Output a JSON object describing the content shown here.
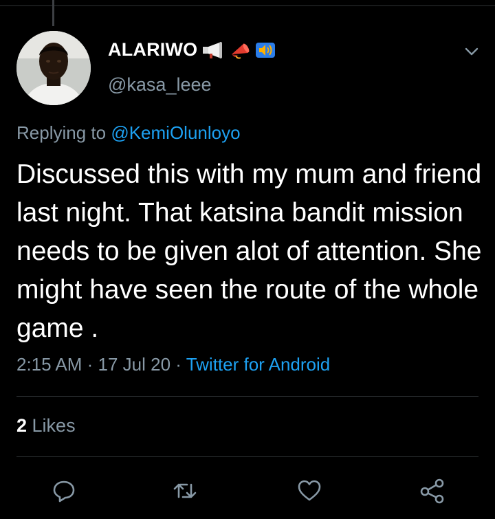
{
  "tweet": {
    "display_name": "ALARIWO",
    "handle": "@kasa_leee",
    "replying_prefix": "Replying to ",
    "replying_to": "@KemiOlunloyo",
    "text": "Discussed this with my mum and friend last night.  That katsina bandit mission needs to be given alot of attention.  She might have seen the route of the whole game .",
    "time": "2:15 AM",
    "separator": " · ",
    "date": "17 Jul 20",
    "source": "Twitter for Android",
    "likes_count": "2",
    "likes_label": " Likes"
  },
  "icons": {
    "name_emojis": [
      "loudspeaker-icon",
      "megaphone-icon",
      "speaker-volume-icon"
    ],
    "menu": "chevron-down-icon",
    "actions": [
      "reply-icon",
      "retweet-icon",
      "like-icon",
      "share-icon"
    ]
  },
  "colors": {
    "background": "#000000",
    "text": "#ffffff",
    "secondary": "#8899a6",
    "accent": "#1da1f2",
    "divider": "#2f3336"
  }
}
